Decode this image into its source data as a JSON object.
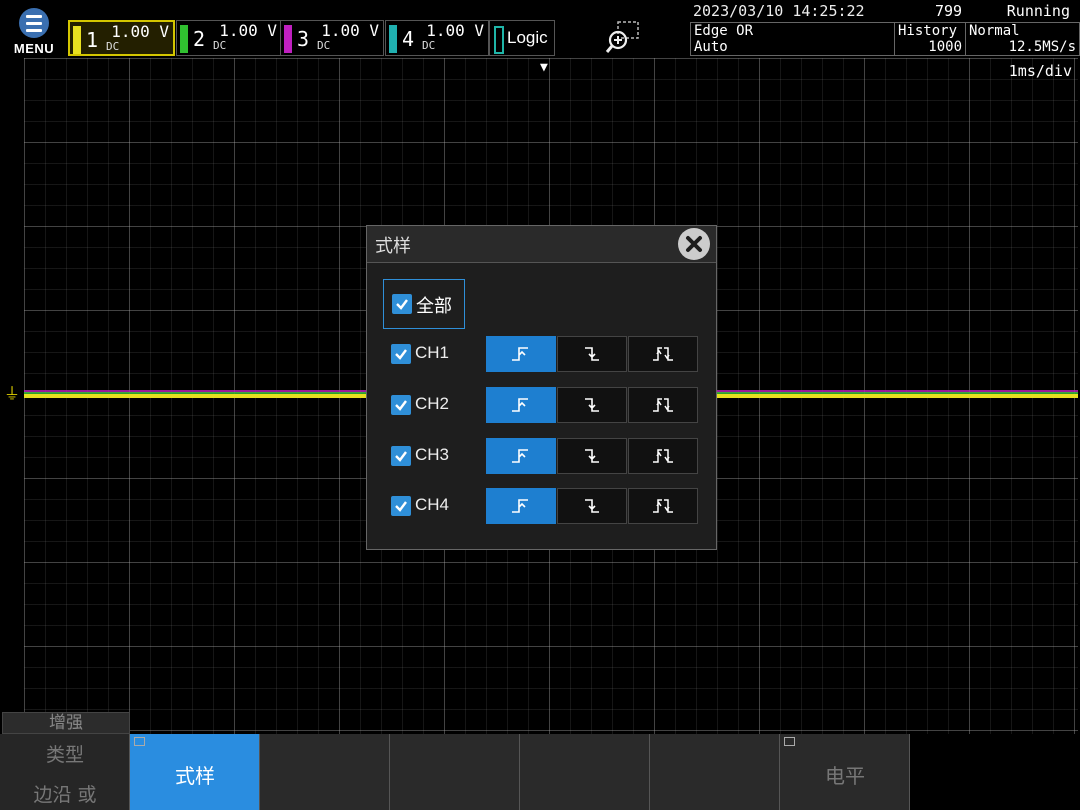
{
  "menu": {
    "label": "MENU"
  },
  "channels": [
    {
      "num": "1",
      "volt": "1.00 V",
      "coupling": "DC",
      "color": "#e8e020"
    },
    {
      "num": "2",
      "volt": "1.00 V",
      "coupling": "DC",
      "color": "#30c030"
    },
    {
      "num": "3",
      "volt": "1.00 V",
      "coupling": "DC",
      "color": "#c020c0"
    },
    {
      "num": "4",
      "volt": "1.00 V",
      "coupling": "DC",
      "color": "#20b0b0"
    }
  ],
  "logic": {
    "label": "Logic"
  },
  "status": {
    "datetime": "2023/03/10 14:25:22",
    "count": "799",
    "run_state": "Running",
    "trigger_type": "Edge OR",
    "trigger_mode": "Auto",
    "history_label": "History",
    "history_value": "1000",
    "acq_mode": "Normal",
    "sample_rate": "12.5MS/s"
  },
  "timebase": "1ms/div",
  "dialog": {
    "title": "式样",
    "all_label": "全部",
    "rows": [
      {
        "label": "CH1",
        "checked": true,
        "selected_edge": "rise"
      },
      {
        "label": "CH2",
        "checked": true,
        "selected_edge": "rise"
      },
      {
        "label": "CH3",
        "checked": true,
        "selected_edge": "rise"
      },
      {
        "label": "CH4",
        "checked": true,
        "selected_edge": "rise"
      }
    ]
  },
  "softkeys": {
    "enhance": "增强",
    "type_label": "类型",
    "type_value": "边沿 或",
    "style": "式样",
    "level": "电平"
  },
  "colors": {
    "accent": "#2a8de0",
    "selected_edge": "#1e7fd0"
  }
}
